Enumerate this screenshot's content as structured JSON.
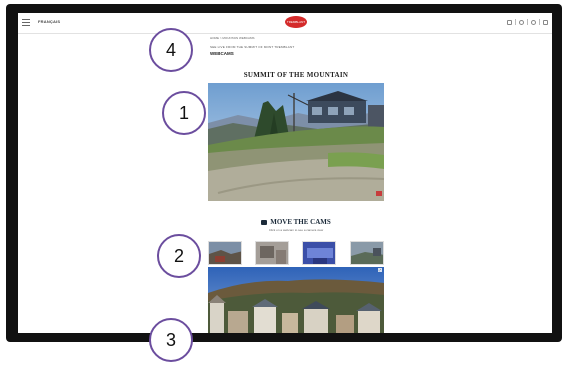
{
  "topbar": {
    "language_label": "FRANÇAIS",
    "logo_text": "TREMBLANT"
  },
  "content": {
    "breadcrumb": "HOME  >  MOUNTAIN WEBCAMS",
    "subheading": "SEE LIVE FROM THE SUMMIT OF MONT TREMBLANT",
    "page_title": "WEBCAMS",
    "main_cam_title": "SUMMIT OF THE MOUNTAIN",
    "section_title": "MOVE THE CAMS",
    "section_subtitle": "Click on a webcam to see a camera view",
    "expand_label": "⤢"
  },
  "callouts": [
    "1",
    "2",
    "3",
    "4"
  ],
  "colors": {
    "callout_border": "#6b4d9e",
    "logo_red": "#d42a2a",
    "heading_navy": "#1c2b3a"
  }
}
